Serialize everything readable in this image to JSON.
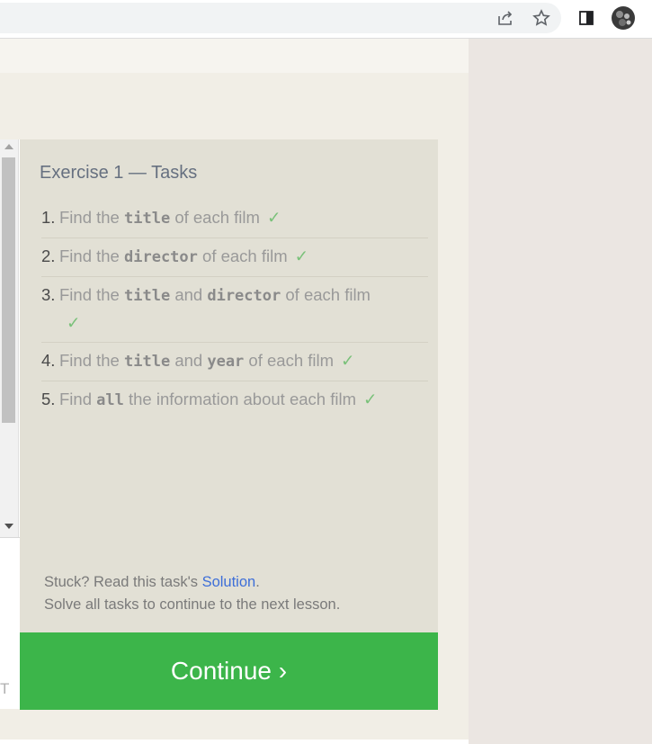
{
  "browser": {
    "icons": [
      "share-icon",
      "star-icon",
      "side-panel-icon",
      "profile-avatar"
    ]
  },
  "editor": {
    "cut_text": "T"
  },
  "exercise": {
    "title": "Exercise 1 — Tasks",
    "tasks": [
      {
        "num": "1.",
        "pre": "Find the ",
        "kw1": "title",
        "mid": "",
        "kw2": "",
        "post": " of each film",
        "check": "✓"
      },
      {
        "num": "2.",
        "pre": "Find the ",
        "kw1": "director",
        "mid": "",
        "kw2": "",
        "post": " of each film",
        "check": "✓"
      },
      {
        "num": "3.",
        "pre": "Find the ",
        "kw1": "title",
        "mid": " and ",
        "kw2": "director",
        "post": " of each film",
        "check": "✓"
      },
      {
        "num": "4.",
        "pre": "Find the ",
        "kw1": "title",
        "mid": " and ",
        "kw2": "year",
        "post": " of each film",
        "check": "✓"
      },
      {
        "num": "5.",
        "pre": "Find ",
        "kw1": "all",
        "mid": "",
        "kw2": "",
        "post": " the information about each film",
        "check": "✓"
      }
    ],
    "stuck_prefix": "Stuck? Read this task's ",
    "solution_link": "Solution",
    "stuck_suffix": ".",
    "solve_text": "Solve all tasks to continue to the next lesson.",
    "continue_label": "Continue ›"
  },
  "colors": {
    "accent_green": "#3cb54a",
    "check_green": "#79c179",
    "link_blue": "#3d6ed8",
    "panel_bg": "#e2e0d5"
  }
}
